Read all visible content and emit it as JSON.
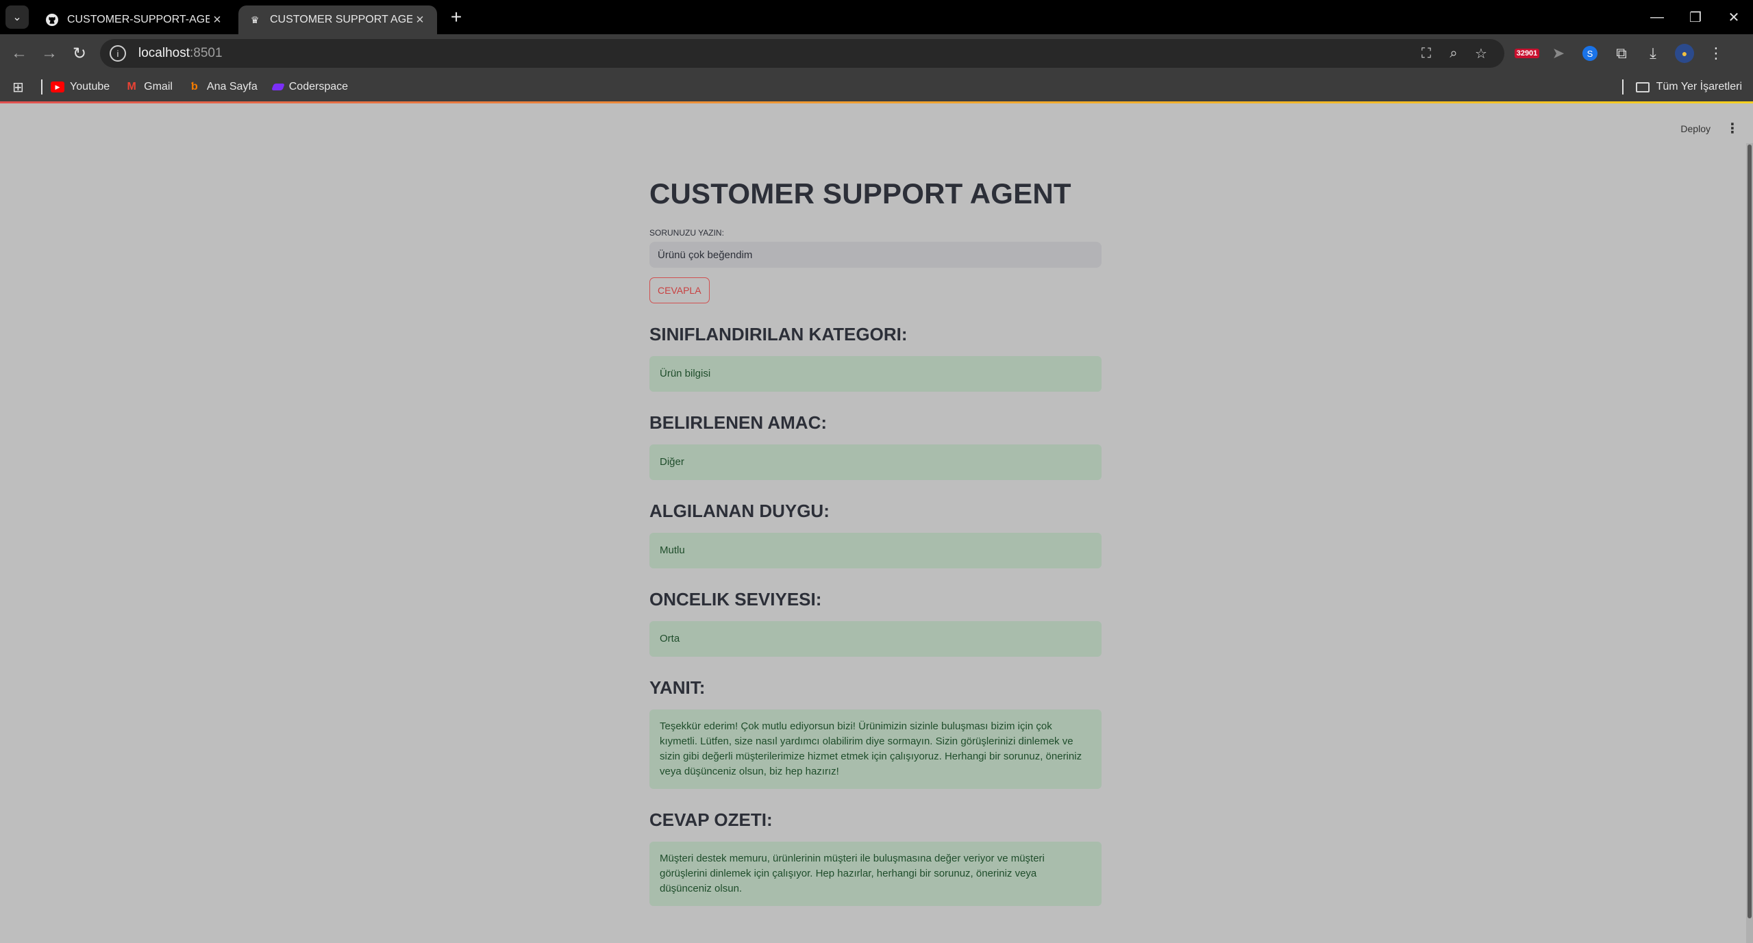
{
  "browser": {
    "tabs": [
      {
        "title": "CUSTOMER-SUPPORT-AGENT/i",
        "favicon": "github-icon",
        "active": false
      },
      {
        "title": "CUSTOMER SUPPORT AGENT",
        "favicon": "streamlit-crown-icon",
        "active": true
      }
    ],
    "url_host": "localhost",
    "url_port": ":8501",
    "extension_badge": "32901",
    "bookmarks": [
      {
        "label": "Youtube",
        "icon": "youtube-icon",
        "color": "#ff0000"
      },
      {
        "label": "Gmail",
        "icon": "gmail-icon",
        "color": "#ea4335"
      },
      {
        "label": "Ana Sayfa",
        "icon": "ana-sayfa-icon",
        "color": "#f57c00"
      },
      {
        "label": "Coderspace",
        "icon": "coderspace-icon",
        "color": "#7b2ff7"
      }
    ],
    "all_bookmarks_label": "Tüm Yer İşaretleri"
  },
  "app": {
    "deploy_label": "Deploy",
    "title": "CUSTOMER SUPPORT AGENT",
    "input_label": "SORUNUZU YAZIN:",
    "input_value": "Ürünü çok beğendim",
    "submit_label": "CEVAPLA",
    "sections": [
      {
        "heading": "SINIFLANDIRILAN KATEGORI:",
        "value": "Ürün bilgisi"
      },
      {
        "heading": "BELIRLENEN AMAC:",
        "value": "Diğer"
      },
      {
        "heading": "ALGILANAN DUYGU:",
        "value": "Mutlu"
      },
      {
        "heading": "ONCELIK SEVIYESI:",
        "value": "Orta"
      },
      {
        "heading": "YANIT:",
        "value": "Teşekkür ederim! Çok mutlu ediyorsun bizi! Ürünimizin sizinle buluşması bizim için çok kıymetli. Lütfen, size nasıl yardımcı olabilirim diye sormayın. Sizin görüşlerinizi dinlemek ve sizin gibi değerli müşterilerimize hizmet etmek için çalışıyoruz. Herhangi bir sorunuz, öneriniz veya düşünceniz olsun, biz hep hazırız!"
      },
      {
        "heading": "CEVAP OZETI:",
        "value": "Müşteri destek memuru, ürünlerinin müşteri ile buluşmasına değer veriyor ve müşteri görüşlerini dinlemek için çalışıyor. Hep hazırlar, herhangi bir sorunuz, öneriniz veya düşünceniz olsun."
      }
    ]
  },
  "colors": {
    "app_background": "#bebebe",
    "result_background": "#a9bdac",
    "result_text": "#1f4d2b",
    "button_accent": "#c84040"
  }
}
